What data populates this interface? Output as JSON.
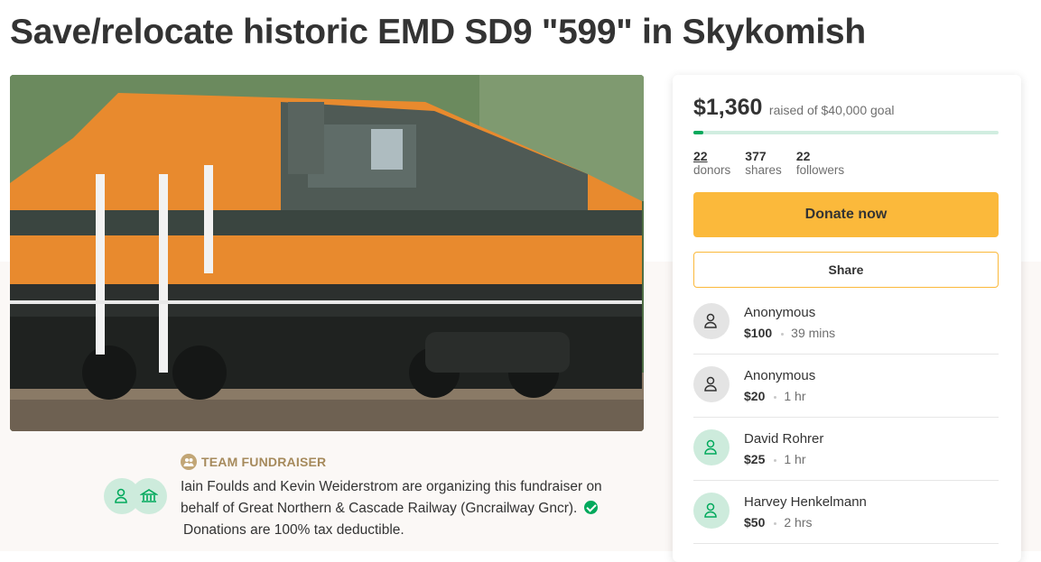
{
  "title": "Save/relocate historic EMD SD9 \"599\" in Skykomish",
  "hero": {
    "icon": "locomotive-photo"
  },
  "organizer": {
    "team_label": "TEAM FUNDRAISER",
    "text": "Iain Foulds and Kevin Weiderstrom are organizing this fundraiser on behalf of Great Northern & Cascade Railway (Gncrailway Gncr).",
    "tax_note": "Donations are 100% tax deductible."
  },
  "card": {
    "raised": "$1,360",
    "goal_text": "raised of $40,000 goal",
    "progress_fraction": 0.034,
    "stats": [
      {
        "number": "22",
        "label": "donors"
      },
      {
        "number": "377",
        "label": "shares"
      },
      {
        "number": "22",
        "label": "followers"
      }
    ],
    "donate_label": "Donate now",
    "share_label": "Share",
    "donations": [
      {
        "name": "Anonymous",
        "amount": "$100",
        "time": "39 mins",
        "avatar": "gray"
      },
      {
        "name": "Anonymous",
        "amount": "$20",
        "time": "1 hr",
        "avatar": "gray"
      },
      {
        "name": "David Rohrer",
        "amount": "$25",
        "time": "1 hr",
        "avatar": "green"
      },
      {
        "name": "Harvey Henkelmann",
        "amount": "$50",
        "time": "2 hrs",
        "avatar": "green"
      }
    ]
  },
  "colors": {
    "accent": "#fbb93b",
    "green": "#02a95c",
    "progress_track": "#d1ede0"
  }
}
